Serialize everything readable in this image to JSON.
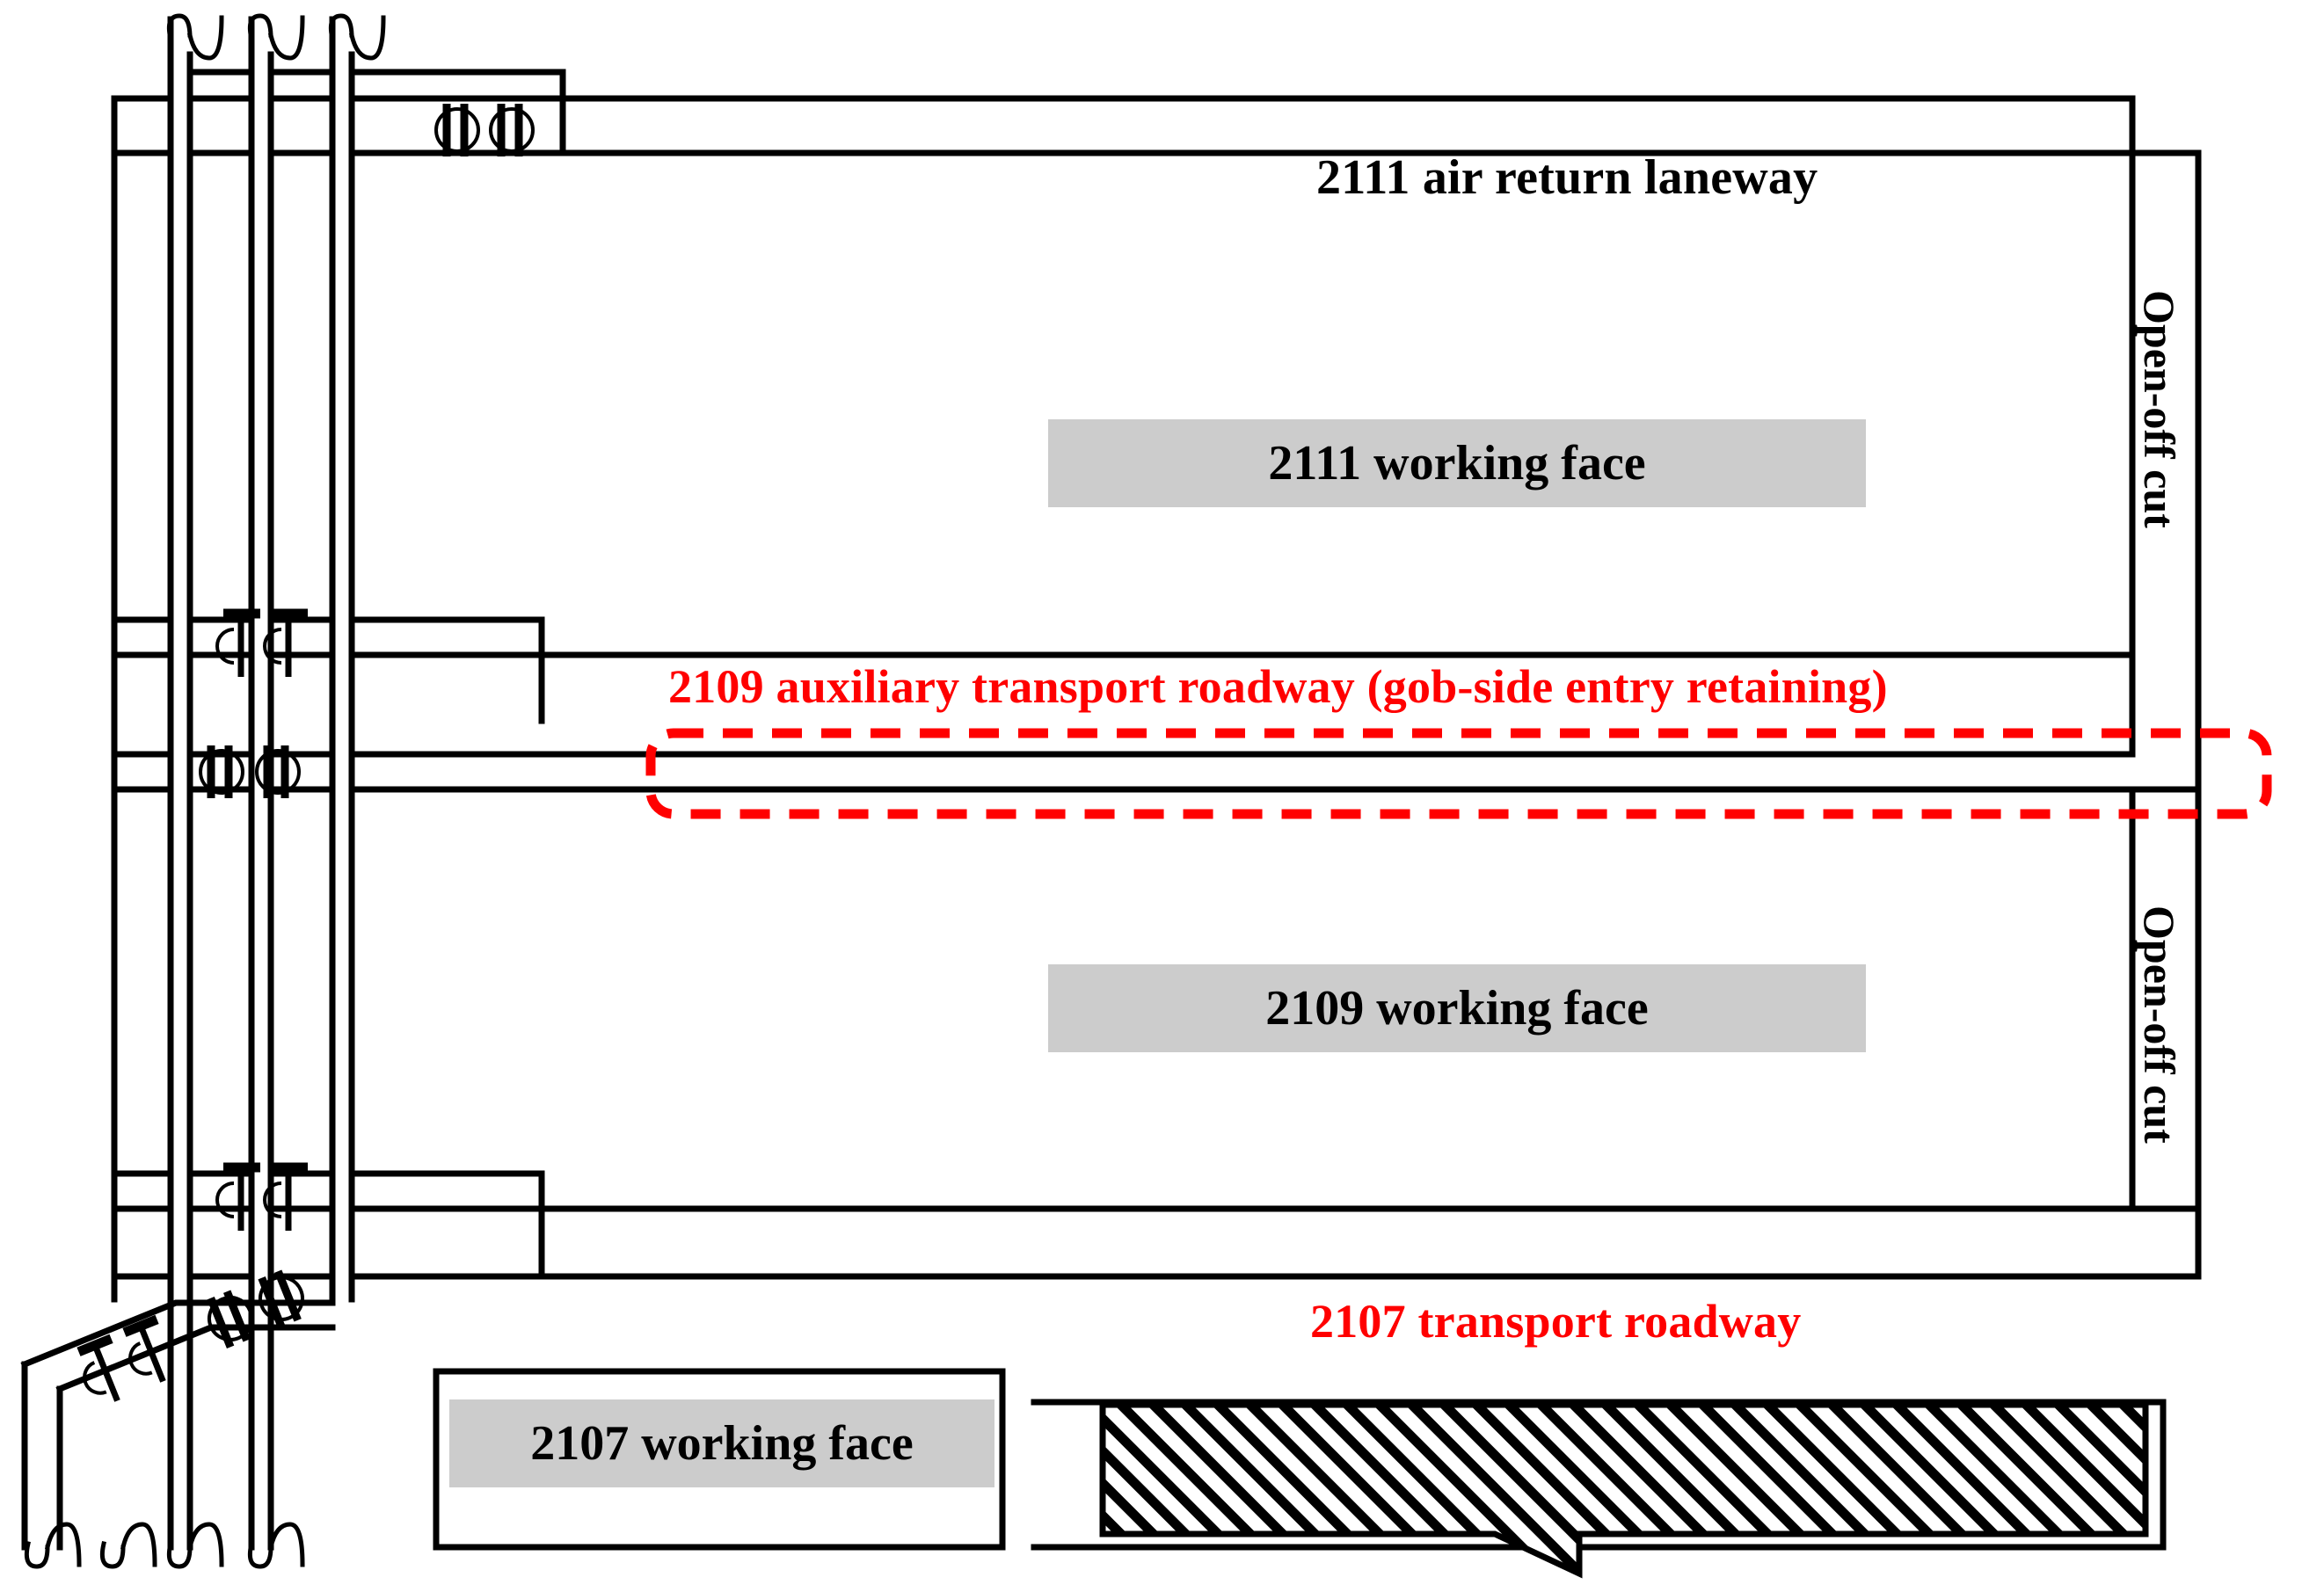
{
  "diagram": {
    "title_semantics": "underground coal mine panel layout plan",
    "colors": {
      "line": "#000000",
      "highlight_red": "#ff0000",
      "face_fill": "#cccccc",
      "background": "#ffffff"
    },
    "labels": {
      "air_return_laneway": "2111 air return laneway",
      "face_2111": "2111 working face",
      "auxiliary_roadway": "2109 auxiliary transport roadway  (gob-side entry retaining)",
      "face_2109": "2109 working face",
      "transport_roadway": "2107 transport roadway",
      "face_2107": "2107 working face",
      "open_off_cut_upper": "Open-off cut",
      "open_off_cut_lower": "Open-off cut"
    },
    "symbols": {
      "ventilation_door": "ventilation-door",
      "air_regulator_door": "air-regulator-door",
      "break_line": "roadway-break-line",
      "hatch": "goaf-hatching"
    }
  },
  "chart_data": {
    "type": "diagram",
    "title": "Mining panel layout",
    "elements": [
      {
        "name": "2111 air return laneway",
        "kind": "roadway-label",
        "color": "#000000"
      },
      {
        "name": "2111 working face",
        "kind": "face-block",
        "color": "#cccccc"
      },
      {
        "name": "2109 auxiliary transport roadway  (gob-side entry retaining)",
        "kind": "roadway-label",
        "color": "#ff0000",
        "outlined": "red-dashed"
      },
      {
        "name": "2109 working face",
        "kind": "face-block",
        "color": "#cccccc"
      },
      {
        "name": "2107 transport roadway",
        "kind": "roadway-label",
        "color": "#ff0000"
      },
      {
        "name": "2107 working face",
        "kind": "face-block",
        "color": "#cccccc"
      },
      {
        "name": "Open-off cut",
        "kind": "vertical-label",
        "color": "#000000"
      },
      {
        "name": "Open-off cut",
        "kind": "vertical-label",
        "color": "#000000"
      }
    ]
  }
}
